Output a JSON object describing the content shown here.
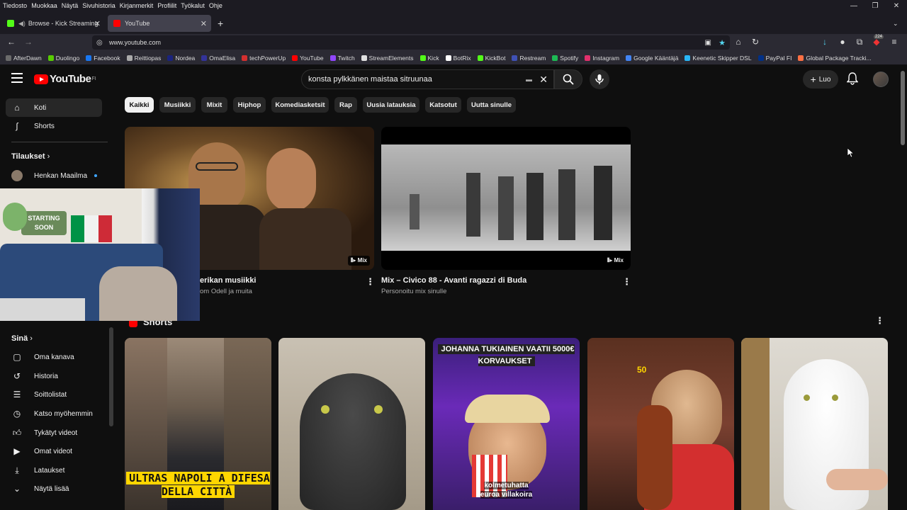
{
  "menubar": {
    "items": [
      "Tiedosto",
      "Muokkaa",
      "Näytä",
      "Sivuhistoria",
      "Kirjanmerkit",
      "Profiilit",
      "Työkalut",
      "Ohje"
    ]
  },
  "tabs": [
    {
      "label": "Browse - Kick Streaming",
      "color": "#53fc18"
    },
    {
      "label": "YouTube",
      "color": "#ff0000"
    }
  ],
  "nav": {
    "url": "www.youtube.com",
    "download_badge": "224"
  },
  "bookmarks": [
    {
      "label": "AfterDawn",
      "color": "#6b6b6b"
    },
    {
      "label": "Duolingo",
      "color": "#58cc02"
    },
    {
      "label": "Facebook",
      "color": "#1877f2"
    },
    {
      "label": "Reittiopas",
      "color": "#aaaaaa"
    },
    {
      "label": "Nordea",
      "color": "#1a237e"
    },
    {
      "label": "OmaElisa",
      "color": "#333399"
    },
    {
      "label": "techPowerUp",
      "color": "#d32f2f"
    },
    {
      "label": "YouTube",
      "color": "#ff0000"
    },
    {
      "label": "Twitch",
      "color": "#9146ff"
    },
    {
      "label": "StreamElements",
      "color": "#e0e0e0"
    },
    {
      "label": "Kick",
      "color": "#53fc18"
    },
    {
      "label": "BotRix",
      "color": "#ffffff"
    },
    {
      "label": "KickBot",
      "color": "#53fc18"
    },
    {
      "label": "Restream",
      "color": "#3f51b5"
    },
    {
      "label": "Spotify",
      "color": "#1db954"
    },
    {
      "label": "Instagram",
      "color": "#e1306c"
    },
    {
      "label": "Google Kääntäjä",
      "color": "#4285f4"
    },
    {
      "label": "Keenetic Skipper DSL",
      "color": "#29b6f6"
    },
    {
      "label": "PayPal FI",
      "color": "#003087"
    },
    {
      "label": "Global Package Tracki...",
      "color": "#ff7043"
    }
  ],
  "youtube": {
    "logo_text": "YouTube",
    "logo_region": "FI",
    "search_value": "konsta pylkkänen maistaa sitruunaa",
    "create_label": "Luo"
  },
  "sidebar": {
    "top": [
      {
        "label": "Koti",
        "icon": "home-icon"
      },
      {
        "label": "Shorts",
        "icon": "shorts-icon"
      }
    ],
    "subscriptions_title": "Tilaukset",
    "subscriptions": [
      {
        "label": "Henkan Maailma"
      }
    ],
    "you_title": "Sinä",
    "you": [
      {
        "label": "Oma kanava",
        "icon": "channel-icon"
      },
      {
        "label": "Historia",
        "icon": "history-icon"
      },
      {
        "label": "Soittolistat",
        "icon": "playlists-icon"
      },
      {
        "label": "Katso myöhemmin",
        "icon": "watch-later-icon"
      },
      {
        "label": "Tykätyt videot",
        "icon": "liked-icon"
      },
      {
        "label": "Omat videot",
        "icon": "my-videos-icon"
      },
      {
        "label": "Lataukset",
        "icon": "downloads-icon"
      },
      {
        "label": "Näytä lisää",
        "icon": "chevron-down-icon"
      }
    ]
  },
  "chips": [
    "Kaikki",
    "Musiikki",
    "Mixit",
    "Hiphop",
    "Komediasketsit",
    "Rap",
    "Uusia latauksia",
    "Katsotut",
    "Uutta sinulle"
  ],
  "videos": [
    {
      "title": "erikan musiikki",
      "subtitle": "om Odell ja muita",
      "badge": "Mix"
    },
    {
      "title": "Mix – Civico 88 - Avanti ragazzi di Buda",
      "subtitle": "Personoitu mix sinulle",
      "badge": "Mix"
    }
  ],
  "shorts": {
    "title": "Shorts",
    "items": [
      {
        "caption": "ULTRAS NAPOLI A DIFESA DELLA CITTÀ"
      },
      {
        "caption": ""
      },
      {
        "caption_top": "JOHANNA TUKIAINEN VAATII 5000€ KORVAUKSET",
        "caption_bottom": "kolmetuhatta euroa villakoira"
      },
      {
        "caption": ""
      },
      {
        "caption": ""
      }
    ]
  },
  "webcam": {
    "sign_line1": "STARTING",
    "sign_line2": "SOON"
  }
}
